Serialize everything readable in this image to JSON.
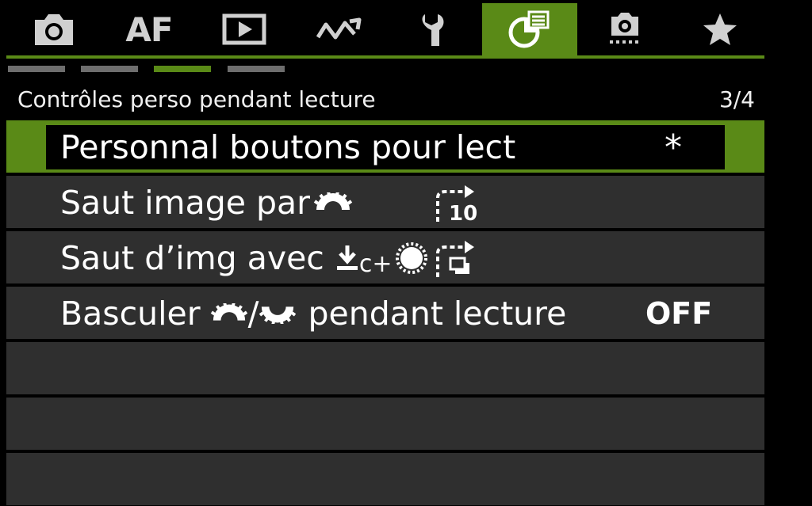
{
  "tabs": [
    {
      "icon": "camera-icon"
    },
    {
      "label": "AF"
    },
    {
      "icon": "playback-icon"
    },
    {
      "icon": "wave-icon"
    },
    {
      "icon": "wrench-icon"
    },
    {
      "icon": "custom-controls-icon",
      "active": true
    },
    {
      "icon": "camera-settings-icon"
    },
    {
      "icon": "star-icon"
    }
  ],
  "page_indicator": {
    "count": 4,
    "active": 3
  },
  "header": {
    "title": "Contrôles perso pendant lecture",
    "page": "3/4"
  },
  "menu": {
    "items": [
      {
        "label": "Personnal boutons pour lect",
        "value": "*",
        "selected": true
      },
      {
        "label": "Saut image par",
        "value_icon": "jump-10-icon"
      },
      {
        "label": "Saut d’img avec",
        "label_suffix_text": "c+",
        "value_icon": "jump-images-icon"
      },
      {
        "label_before": "Basculer",
        "label_mid": "/",
        "label_after": "pendant lecture",
        "value": "OFF"
      }
    ]
  },
  "colors": {
    "accent": "#5a8a17",
    "row": "#2f2f2f",
    "background": "#000000",
    "inactive_dash": "#6e6e6e"
  }
}
